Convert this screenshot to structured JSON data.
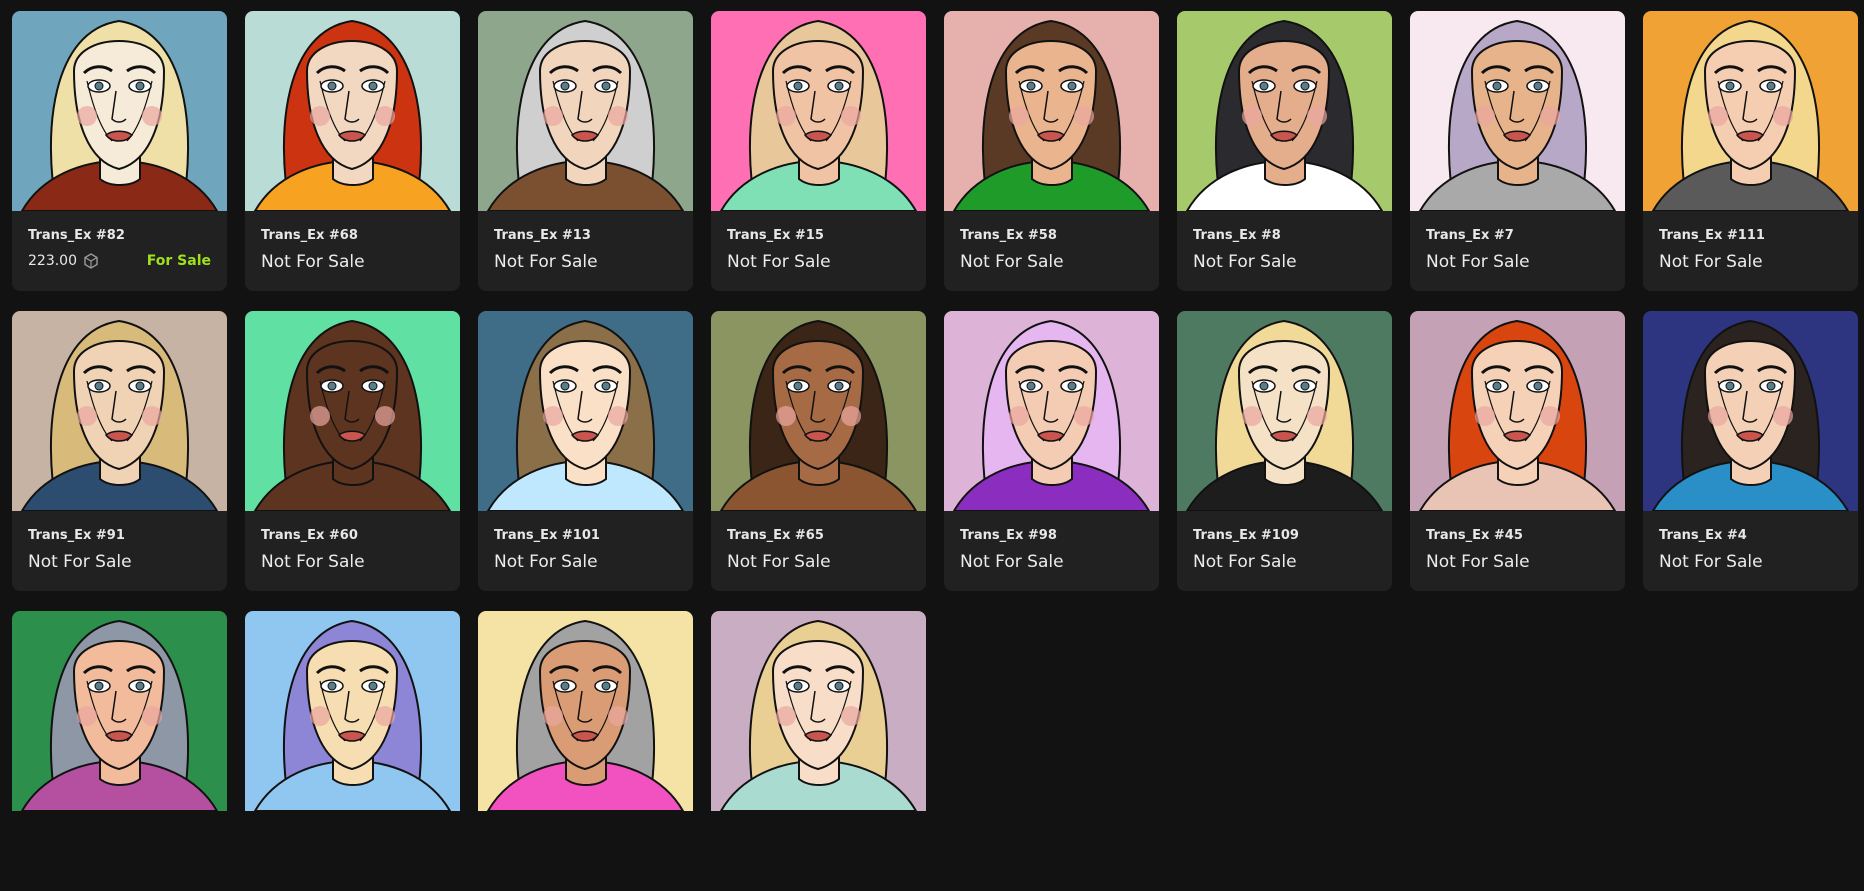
{
  "cards": [
    {
      "name": "Trans_Ex #82",
      "price": "223.00",
      "status": "For Sale",
      "bg": "#6fa6bd",
      "skin": "#f6ead8",
      "hair": "#efe0a8",
      "accent": "#8a2a16"
    },
    {
      "name": "Trans_Ex #68",
      "status": "Not For Sale",
      "bg": "#b9dcd6",
      "skin": "#f2d7c1",
      "hair": "#cc3310",
      "accent": "#f7a321"
    },
    {
      "name": "Trans_Ex #13",
      "status": "Not For Sale",
      "bg": "#8ea68c",
      "skin": "#f1d6bd",
      "hair": "#cfcfcf",
      "accent": "#7a5030"
    },
    {
      "name": "Trans_Ex #15",
      "status": "Not For Sale",
      "bg": "#ff6fb4",
      "skin": "#f0c3a4",
      "hair": "#e8c89a",
      "accent": "#7fe0b5"
    },
    {
      "name": "Trans_Ex #58",
      "status": "Not For Sale",
      "bg": "#e6b0ac",
      "skin": "#eab58e",
      "hair": "#5b3a25",
      "accent": "#1f9b2a"
    },
    {
      "name": "Trans_Ex #8",
      "status": "Not For Sale",
      "bg": "#a6c96b",
      "skin": "#e4ad8c",
      "hair": "#2b2b2f",
      "accent": "#ffffff"
    },
    {
      "name": "Trans_Ex #7",
      "status": "Not For Sale",
      "bg": "#f7e9ef",
      "skin": "#e6b38b",
      "hair": "#b8a8c8",
      "accent": "#a9a9a9"
    },
    {
      "name": "Trans_Ex #111",
      "status": "Not For Sale",
      "bg": "#f0a234",
      "skin": "#f5cdb1",
      "hair": "#f2d78c",
      "accent": "#5a5a5a"
    },
    {
      "name": "Trans_Ex #91",
      "status": "Not For Sale",
      "bg": "#c7b3a3",
      "skin": "#f0d2b5",
      "hair": "#d8ba7a",
      "accent": "#2d4d70"
    },
    {
      "name": "Trans_Ex #60",
      "status": "Not For Sale",
      "bg": "#61e0a4",
      "skin": "#5d3420",
      "hair": "#5d3420",
      "accent": "#5d3420"
    },
    {
      "name": "Trans_Ex #101",
      "status": "Not For Sale",
      "bg": "#3f6d87",
      "skin": "#fbe0c8",
      "hair": "#8a6f49",
      "accent": "#bfe8ff"
    },
    {
      "name": "Trans_Ex #65",
      "status": "Not For Sale",
      "bg": "#8a9562",
      "skin": "#a66a44",
      "hair": "#3a2516",
      "accent": "#8a5530"
    },
    {
      "name": "Trans_Ex #98",
      "status": "Not For Sale",
      "bg": "#ddb4d8",
      "skin": "#f3ccb3",
      "hair": "#e6b6f0",
      "accent": "#8b2ec0"
    },
    {
      "name": "Trans_Ex #109",
      "status": "Not For Sale",
      "bg": "#4f7a62",
      "skin": "#f4e1c6",
      "hair": "#f1da97",
      "accent": "#1d1d1d"
    },
    {
      "name": "Trans_Ex #45",
      "status": "Not For Sale",
      "bg": "#c4a1b5",
      "skin": "#f5d1b8",
      "hair": "#d9450f",
      "accent": "#e9c4b5"
    },
    {
      "name": "Trans_Ex #4",
      "status": "Not For Sale",
      "bg": "#2e3580",
      "skin": "#f4d1b6",
      "hair": "#2a2320",
      "accent": "#2a8fc7"
    },
    {
      "name": "",
      "status": "",
      "bg": "#2c8f4c",
      "skin": "#f1bb9c",
      "hair": "#8e97a6",
      "accent": "#b54fa0",
      "partial": true
    },
    {
      "name": "",
      "status": "",
      "bg": "#8fc7f0",
      "skin": "#f7ddb2",
      "hair": "#8d86d6",
      "accent": "#8fc7f0",
      "partial": true
    },
    {
      "name": "",
      "status": "",
      "bg": "#f5e3a6",
      "skin": "#d99c74",
      "hair": "#a2a2a2",
      "accent": "#f251c0",
      "partial": true
    },
    {
      "name": "",
      "status": "",
      "bg": "#c9adc2",
      "skin": "#f8dec8",
      "hair": "#e9cf94",
      "accent": "#a9dbd0",
      "partial": true
    }
  ]
}
